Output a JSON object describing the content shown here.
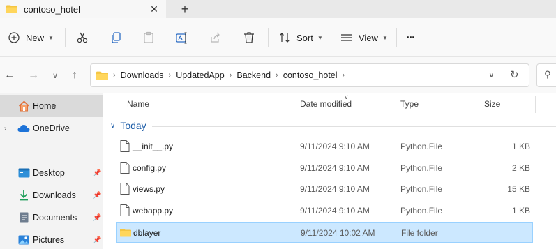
{
  "tab": {
    "title": "contoso_hotel",
    "close": "✕",
    "new_tab": "+"
  },
  "toolbar": {
    "new_label": "New",
    "sort_label": "Sort",
    "view_label": "View",
    "more_label": "···"
  },
  "address": {
    "breadcrumbs": [
      "Downloads",
      "UpdatedApp",
      "Backend",
      "contoso_hotel"
    ]
  },
  "sidebar": {
    "items": [
      {
        "label": "Home",
        "icon": "home-icon",
        "selected": true
      },
      {
        "label": "OneDrive",
        "icon": "onedrive-icon"
      },
      {
        "label": "Desktop",
        "icon": "desktop-icon",
        "pinned": true
      },
      {
        "label": "Downloads",
        "icon": "downloads-icon",
        "pinned": true
      },
      {
        "label": "Documents",
        "icon": "documents-icon",
        "pinned": true
      },
      {
        "label": "Pictures",
        "icon": "pictures-icon",
        "pinned": true
      }
    ]
  },
  "columns": {
    "name": "Name",
    "date": "Date modified",
    "type": "Type",
    "size": "Size"
  },
  "group": {
    "label": "Today"
  },
  "files": [
    {
      "name": "__init__.py",
      "date": "9/11/2024 9:10 AM",
      "type": "Python.File",
      "size": "1 KB",
      "kind": "file"
    },
    {
      "name": "config.py",
      "date": "9/11/2024 9:10 AM",
      "type": "Python.File",
      "size": "2 KB",
      "kind": "file"
    },
    {
      "name": "views.py",
      "date": "9/11/2024 9:10 AM",
      "type": "Python.File",
      "size": "15 KB",
      "kind": "file"
    },
    {
      "name": "webapp.py",
      "date": "9/11/2024 9:10 AM",
      "type": "Python.File",
      "size": "1 KB",
      "kind": "file"
    },
    {
      "name": "dblayer",
      "date": "9/11/2024 10:02 AM",
      "type": "File folder",
      "size": "",
      "kind": "folder",
      "selected": true
    }
  ],
  "colors": {
    "accent": "#1f5ea8",
    "folder": "#f4c542",
    "selection": "#cce8ff"
  }
}
